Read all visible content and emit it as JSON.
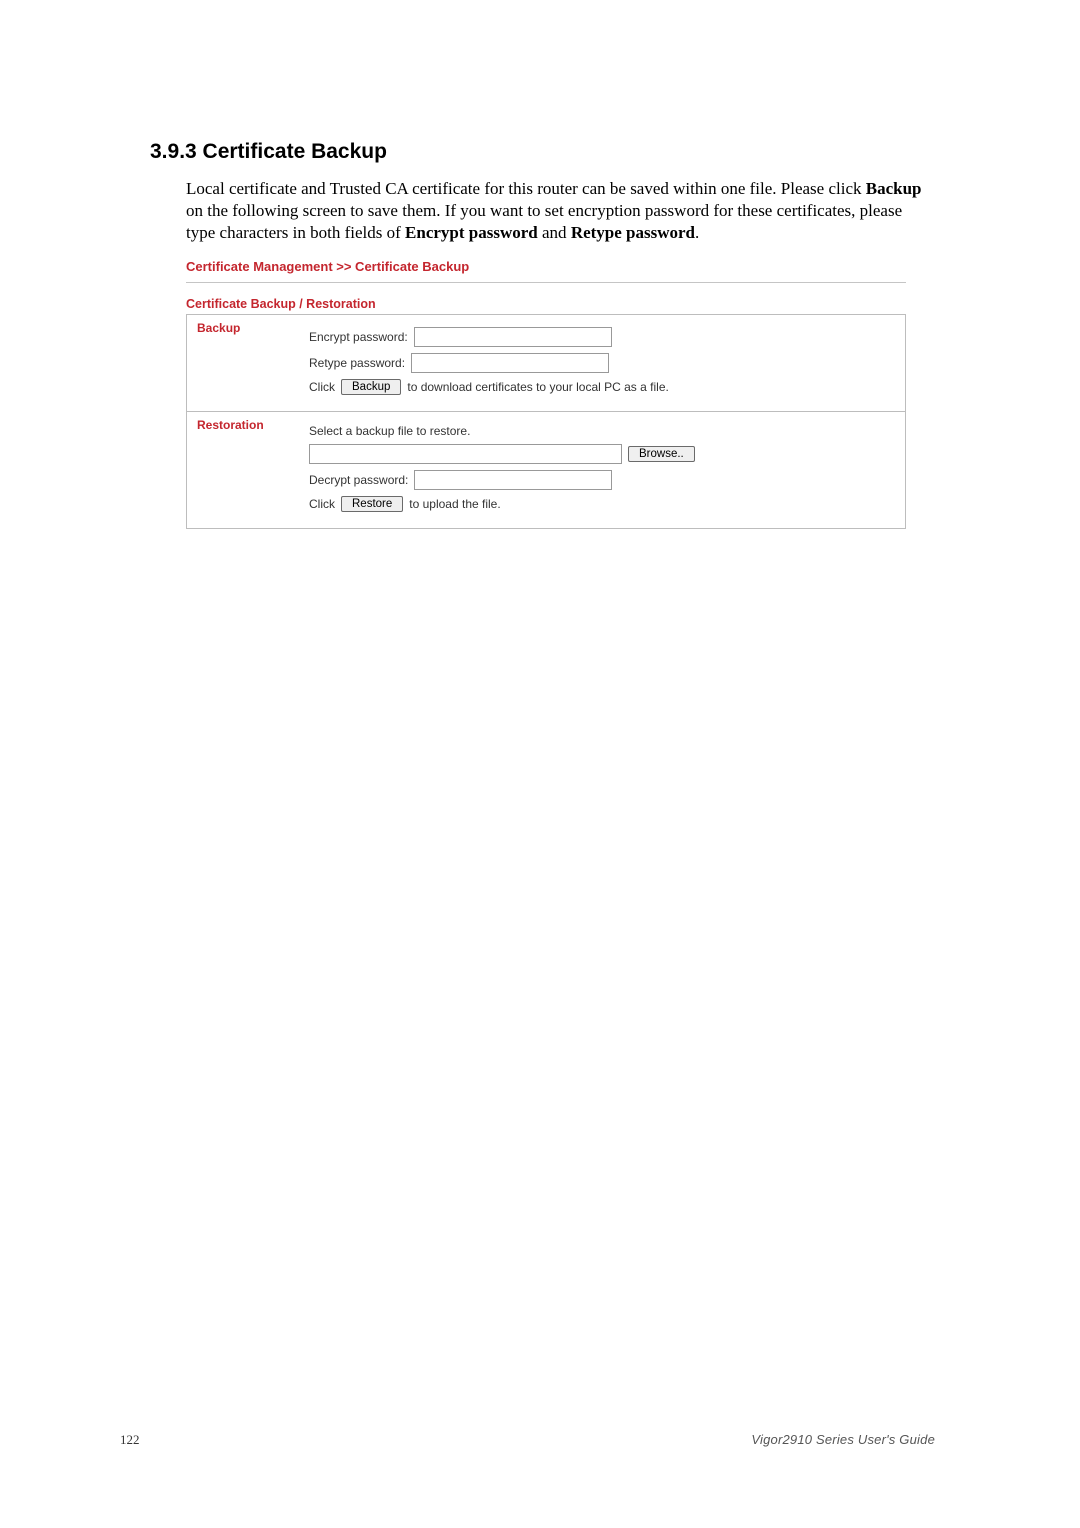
{
  "heading": "3.9.3 Certificate Backup",
  "intro": {
    "part1": "Local certificate and Trusted CA certificate for this router can be saved within one file. Please click ",
    "bold1": "Backup",
    "part2": " on the following screen to save them. If you want to set encryption password for these certificates, please type characters in both fields of ",
    "bold2": "Encrypt password",
    "part3": " and ",
    "bold3": "Retype password",
    "part4": "."
  },
  "breadcrumb": "Certificate Management >> Certificate Backup",
  "subheading": "Certificate Backup / Restoration",
  "backup": {
    "label": "Backup",
    "encrypt_label": "Encrypt password:",
    "retype_label": "Retype password:",
    "click_prefix": "Click",
    "button": "Backup",
    "click_suffix": "to download certificates to your local PC as a file."
  },
  "restoration": {
    "label": "Restoration",
    "select_text": "Select a backup file to restore.",
    "browse_button": "Browse..",
    "decrypt_label": "Decrypt password:",
    "click_prefix": "Click",
    "button": "Restore",
    "click_suffix": "to upload the file."
  },
  "footer": {
    "page": "122",
    "book": "Vigor2910  Series  User's  Guide"
  }
}
